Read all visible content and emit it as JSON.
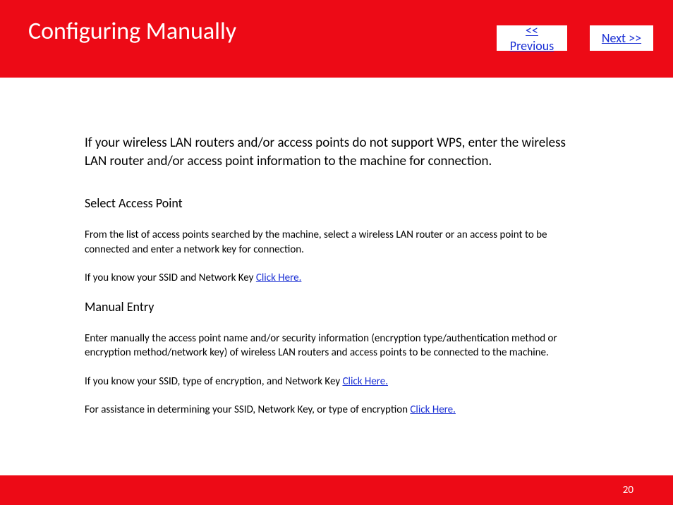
{
  "header": {
    "title": "Configuring Manually",
    "previous_label": "<< Previous",
    "next_label": "Next >>"
  },
  "content": {
    "intro": "If your wireless LAN routers and/or access points do not support WPS, enter the wireless LAN router and/or access point information to the machine for connection.",
    "section1": {
      "label": "Select Access Point",
      "body": "From the list of access points searched by the machine, select a wireless LAN router or an access point to be connected and enter a network key for connection.",
      "line2_prefix": "If you know your SSID and Network Key ",
      "line2_link": "Click Here."
    },
    "section2": {
      "label": "Manual Entry",
      "body": "Enter manually the access point name and/or security information (encryption type/authentication method or encryption method/network key) of wireless LAN routers and access points to be connected to the machine.",
      "line2_prefix": "If you know your SSID, type of encryption, and Network Key ",
      "line2_link": "Click Here.",
      "line3_prefix": "For assistance in determining your SSID, Network Key, or type of encryption ",
      "line3_link": "Click Here."
    }
  },
  "footer": {
    "page_number": "20"
  }
}
